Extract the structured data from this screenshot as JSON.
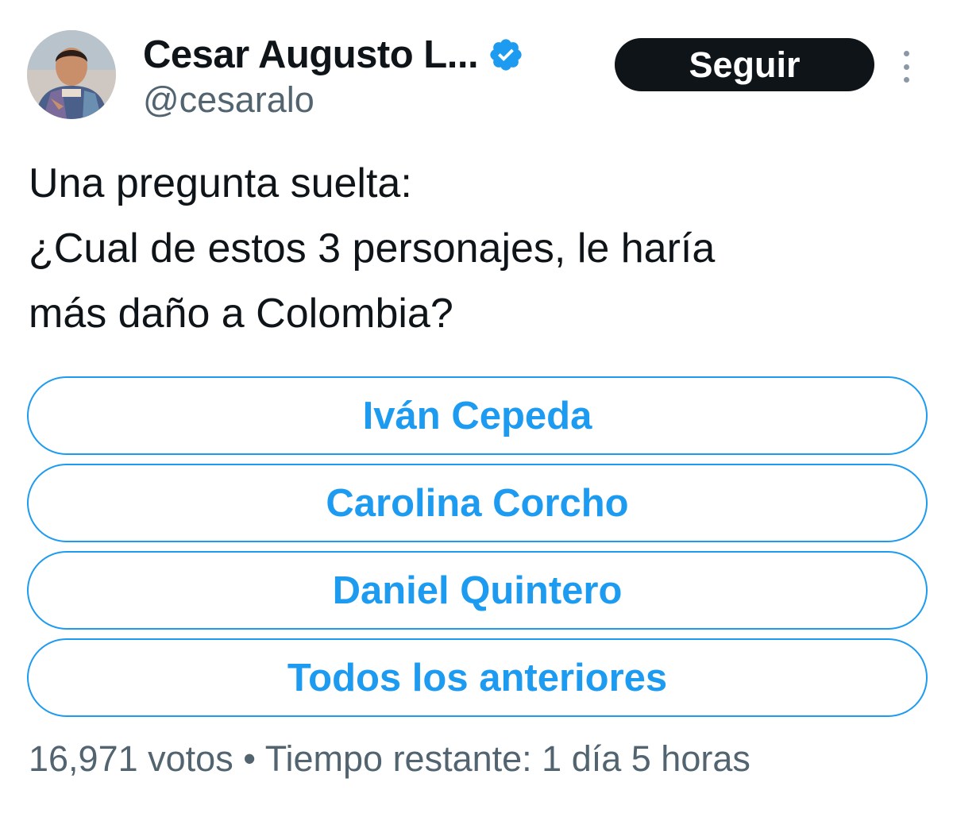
{
  "author": {
    "display_name": "Cesar Augusto L...",
    "handle": "@cesaralo",
    "verified_icon": "verified-badge-icon",
    "avatar": "profile-photo"
  },
  "actions": {
    "follow_label": "Seguir",
    "more_icon": "more-vertical-icon"
  },
  "tweet": {
    "lines": [
      "Una pregunta suelta:",
      "¿Cual de estos 3 personajes, le haría",
      "más daño a Colombia?"
    ]
  },
  "poll": {
    "options": [
      "Iván Cepeda",
      "Carolina Corcho",
      "Daniel Quintero",
      "Todos los anteriores"
    ],
    "votes": "16,971 votos",
    "separator": "•",
    "time_left": "Tiempo restante: 1 día 5 horas"
  },
  "colors": {
    "accent": "#1d9bf0",
    "text": "#0f1419",
    "secondary": "#536471",
    "follow_bg": "#0f1419"
  }
}
